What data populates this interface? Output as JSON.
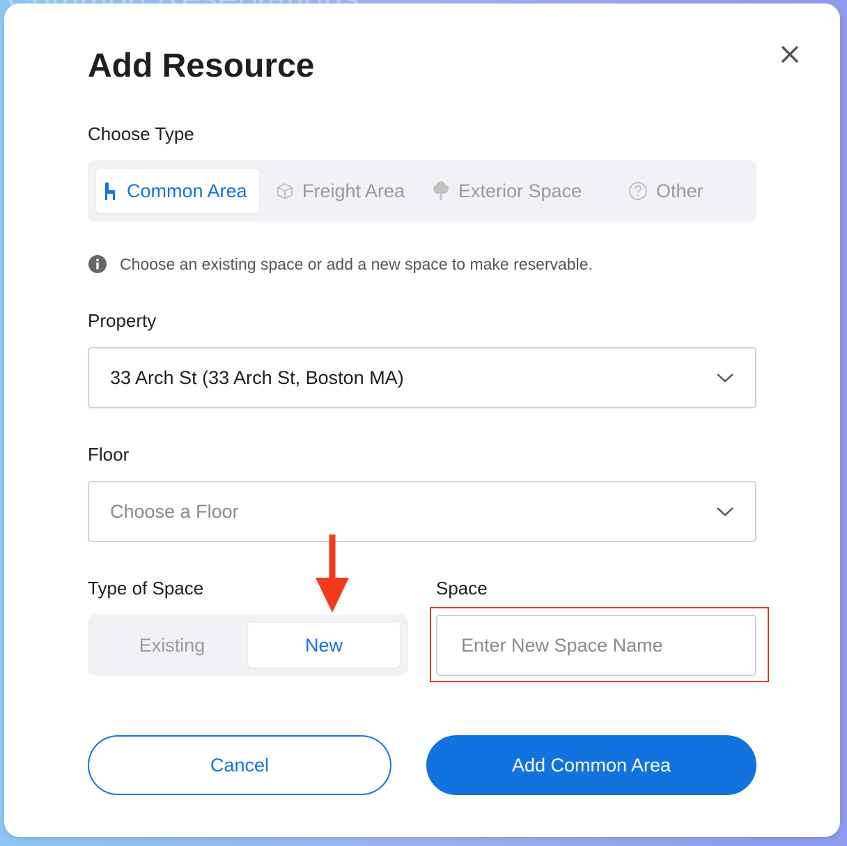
{
  "background": {
    "text": "Common Reservations"
  },
  "modal": {
    "title": "Add Resource",
    "close_icon": "close-icon"
  },
  "choose_type": {
    "label": "Choose Type",
    "options": [
      {
        "label": "Common Area",
        "icon": "chair-icon",
        "selected": true
      },
      {
        "label": "Freight Area",
        "icon": "box-icon",
        "selected": false
      },
      {
        "label": "Exterior Space",
        "icon": "tree-icon",
        "selected": false
      },
      {
        "label": "Other",
        "icon": "question-icon",
        "selected": false
      }
    ]
  },
  "info": {
    "text": "Choose an existing space or add a new space to make reservable.",
    "icon": "info-icon"
  },
  "property": {
    "label": "Property",
    "value": "33 Arch St (33 Arch St, Boston MA)"
  },
  "floor": {
    "label": "Floor",
    "placeholder": "Choose a Floor"
  },
  "type_of_space": {
    "label": "Type of Space",
    "options": [
      {
        "label": "Existing",
        "selected": false
      },
      {
        "label": "New",
        "selected": true
      }
    ]
  },
  "space": {
    "label": "Space",
    "placeholder": "Enter New Space Name",
    "value": ""
  },
  "buttons": {
    "cancel": "Cancel",
    "submit": "Add Common Area"
  },
  "colors": {
    "accent": "#1273de",
    "highlight": "#e8391d",
    "arrow": "#f23a1c"
  }
}
